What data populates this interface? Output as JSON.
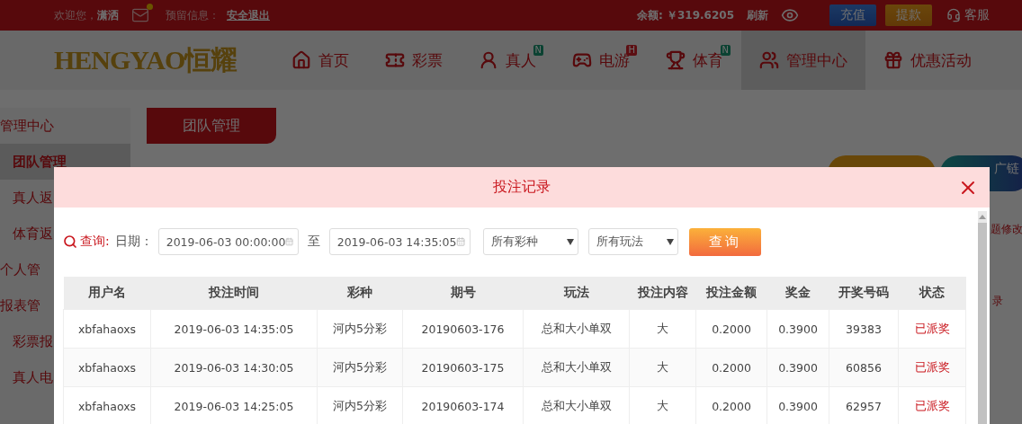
{
  "top_bar": {
    "welcome": "欢迎您，",
    "username": "潇洒",
    "has_new_mail": true,
    "notice_label": "预留信息：",
    "logout": "安全退出",
    "balance": "余额: ￥319.6205",
    "refresh": "刷新",
    "recharge": "充值",
    "withdraw": "提款",
    "support": "客服"
  },
  "nav": {
    "logo": "HENGYAO恒耀",
    "items": [
      {
        "label": "首页",
        "kind": "home",
        "selected": false
      },
      {
        "label": "彩票",
        "kind": "ticket",
        "selected": false
      },
      {
        "label": "真人",
        "kind": "live",
        "badge": "N",
        "selected": false
      },
      {
        "label": "电游",
        "kind": "slot",
        "badge": "H",
        "selected": false
      },
      {
        "label": "体育",
        "kind": "sport",
        "badge": "N",
        "selected": false
      },
      {
        "label": "管理中心",
        "kind": "manage",
        "selected": true
      },
      {
        "label": "优惠活动",
        "kind": "gift",
        "selected": false
      }
    ]
  },
  "sidebar": {
    "header": "管理中心",
    "items": [
      {
        "label": "团队管理",
        "selected": true,
        "kind": "sub"
      },
      {
        "label": "真人返",
        "selected": false,
        "kind": "sub"
      },
      {
        "label": "体育返",
        "selected": false,
        "kind": "sub"
      },
      {
        "label": "个人管",
        "selected": false,
        "kind": "group"
      },
      {
        "label": "报表管",
        "selected": false,
        "kind": "group"
      },
      {
        "label": "彩票报",
        "selected": false,
        "kind": "sub"
      },
      {
        "label": "真人电",
        "selected": false,
        "kind": "sub"
      }
    ]
  },
  "content": {
    "tab": "团队管理",
    "link_button": "广链",
    "side_link": "题修改",
    "side_tab": "录"
  },
  "modal": {
    "title": "投注记录",
    "filter": {
      "label": "查询:",
      "date_label": "日期：",
      "start": "2019-06-03 00:00:00",
      "to": "至",
      "end": "2019-06-03 14:35:05",
      "lottery": "所有彩种",
      "play": "所有玩法",
      "submit": "查询"
    },
    "table": {
      "columns": [
        "用户名",
        "投注时间",
        "彩种",
        "期号",
        "玩法",
        "投注内容",
        "投注金额",
        "奖金",
        "开奖号码",
        "状态"
      ],
      "rows": [
        [
          "xbfahaoxs",
          "2019-06-03 14:35:05",
          "河内5分彩",
          "20190603-176",
          "总和大小单双",
          "大",
          "0.2000",
          "0.3900",
          "39383",
          "已派奖"
        ],
        [
          "xbfahaoxs",
          "2019-06-03 14:30:05",
          "河内5分彩",
          "20190603-175",
          "总和大小单双",
          "大",
          "0.2000",
          "0.3900",
          "60856",
          "已派奖"
        ],
        [
          "xbfahaoxs",
          "2019-06-03 14:25:05",
          "河内5分彩",
          "20190603-174",
          "总和大小单双",
          "大",
          "0.2000",
          "0.3900",
          "62957",
          "已派奖"
        ]
      ]
    }
  }
}
